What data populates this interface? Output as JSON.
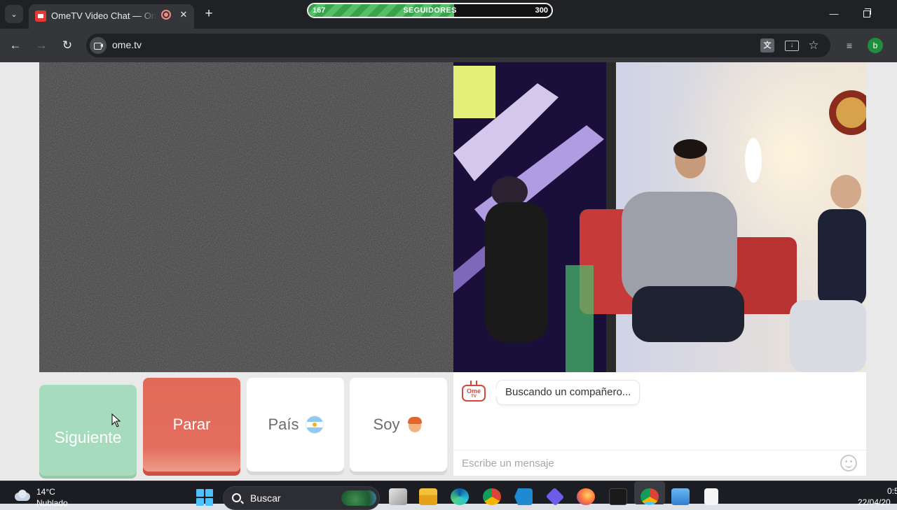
{
  "browser": {
    "tab": {
      "title": "OmeTV Video Chat — Ome",
      "close_label": "✕"
    },
    "new_tab_label": "+",
    "tab_search_label": "⌄",
    "followers": {
      "label": "SEGUIDORES",
      "current": "167",
      "goal": "300",
      "progress": 0.6
    },
    "window": {
      "minimize_label": "—",
      "close_label": "✕"
    },
    "toolbar": {
      "back_label": "←",
      "forward_label": "→",
      "reload_label": "↻",
      "url": "ome.tv",
      "translate_label": "文",
      "bookmark_label": "☆",
      "media_label": "≡",
      "profile_initial": "b"
    }
  },
  "page": {
    "buttons": {
      "next": "Siguiente",
      "stop": "Parar",
      "country": "País",
      "gender": "Soy"
    },
    "chat": {
      "logo_line1": "Ome",
      "logo_line2": "TV",
      "status": "Buscando un compañero...",
      "input_placeholder": "Escribe un mensaje"
    },
    "colors": {
      "next": "#a6dcbd",
      "stop": "#e26a59",
      "brand": "#d2493a"
    }
  },
  "taskbar": {
    "weather": {
      "temp": "14°C",
      "desc": "Nublado"
    },
    "search_label": "Buscar",
    "clock": {
      "time": "0:5",
      "date": "22/04/20"
    },
    "apps": [
      "task-view-icon",
      "file-explorer-icon",
      "edge-icon",
      "chrome-icon",
      "vscode-icon",
      "app-icon",
      "firefox-icon",
      "adobe-icon",
      "chrome-profile-icon",
      "photos-icon",
      "document-icon"
    ]
  }
}
